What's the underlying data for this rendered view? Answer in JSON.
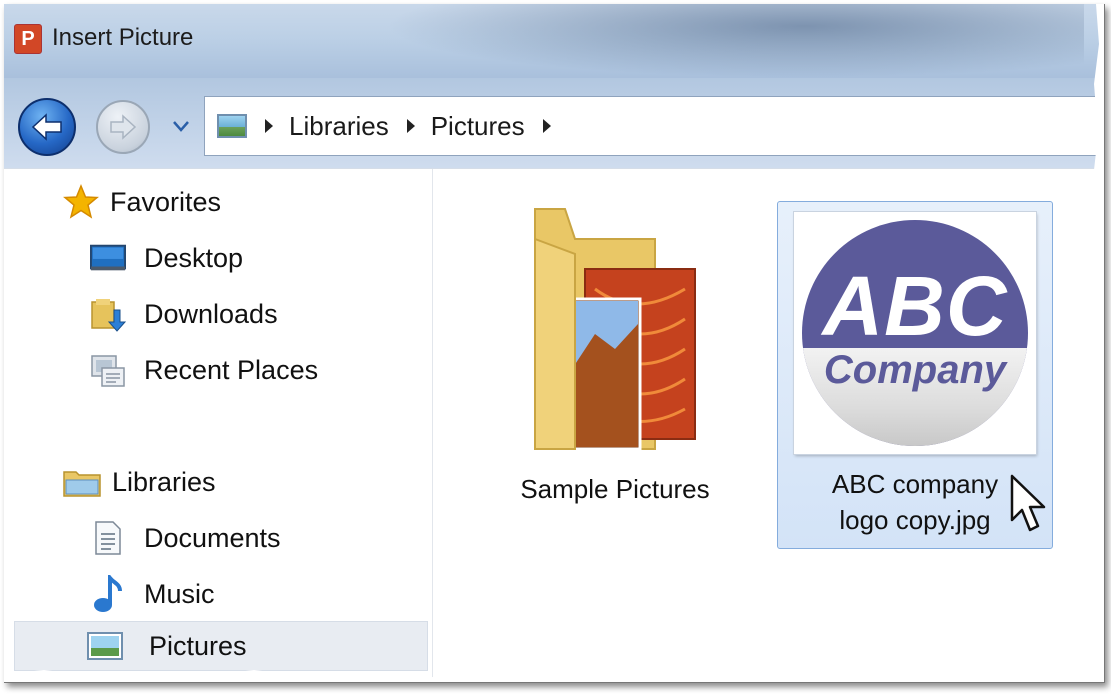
{
  "window": {
    "title": "Insert Picture",
    "app_icon_letter": "P"
  },
  "nav": {
    "breadcrumb": [
      "Libraries",
      "Pictures"
    ]
  },
  "sidebar": {
    "favorites_header": "Favorites",
    "favorites": [
      {
        "label": "Desktop",
        "icon": "desktop-icon"
      },
      {
        "label": "Downloads",
        "icon": "downloads-icon"
      },
      {
        "label": "Recent Places",
        "icon": "recent-places-icon"
      }
    ],
    "libraries_header": "Libraries",
    "libraries": [
      {
        "label": "Documents",
        "icon": "documents-icon"
      },
      {
        "label": "Music",
        "icon": "music-icon"
      },
      {
        "label": "Pictures",
        "icon": "pictures-icon",
        "selected": true
      }
    ]
  },
  "files": [
    {
      "label": "Sample Pictures",
      "type": "folder"
    },
    {
      "label_line1": "ABC company",
      "label_line2": "logo copy.jpg",
      "type": "image",
      "selected": true
    }
  ],
  "logo": {
    "line1": "ABC",
    "line2": "Company"
  },
  "colors": {
    "selection_bg": "#d3e3f7",
    "logo_purple": "#5b5a9a",
    "app_icon": "#d24726"
  }
}
